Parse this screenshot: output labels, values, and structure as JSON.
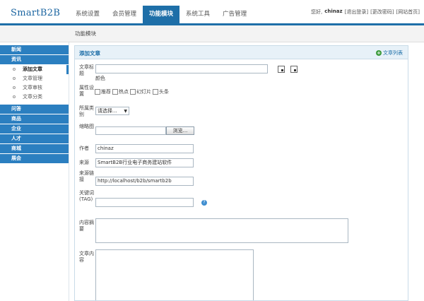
{
  "app": {
    "logo": "SmartB2B"
  },
  "nav": {
    "items": [
      {
        "label": "系统设置",
        "active": false
      },
      {
        "label": "会员管理",
        "active": false
      },
      {
        "label": "功能模块",
        "active": true
      },
      {
        "label": "系统工具",
        "active": false
      },
      {
        "label": "广告管理",
        "active": false
      }
    ]
  },
  "user": {
    "greeting": "您好,",
    "name": "chinaz",
    "links": [
      "[退出登录]",
      "[更改密码]",
      "[网站首页]"
    ]
  },
  "breadcrumb": "功能模块",
  "sidebar": {
    "sections": [
      {
        "label": "新闻"
      },
      {
        "label": "资讯",
        "subs": [
          {
            "label": "添加文章",
            "active": true
          },
          {
            "label": "文章管理",
            "active": false
          },
          {
            "label": "文章审核",
            "active": false
          },
          {
            "label": "文章分类",
            "active": false
          }
        ]
      },
      {
        "label": "问答"
      },
      {
        "label": "商品"
      },
      {
        "label": "企业"
      },
      {
        "label": "人才"
      },
      {
        "label": "商城"
      },
      {
        "label": "展会"
      }
    ]
  },
  "panel": {
    "title": "添加文章",
    "action": "文章列表",
    "labels": {
      "title": "文章标题",
      "attr": "属性设置",
      "cat": "所属类别",
      "thumb": "缩略图",
      "author": "作者",
      "source": "来源",
      "source_url": "来源链接",
      "tags": "关键词(TAG)",
      "summary": "内容摘要",
      "content": "文章内容"
    },
    "title_hint": "颜色",
    "attr_options": [
      "推荐",
      "热点",
      "幻灯片",
      "头条"
    ],
    "category_placeholder": "请选择...",
    "browse_label": "浏览...",
    "author_value": "chinaz",
    "source_value": "SmartB2B行业电子商务建站软件",
    "source_url_value": "http://localhost/b2b/smartb2b"
  }
}
